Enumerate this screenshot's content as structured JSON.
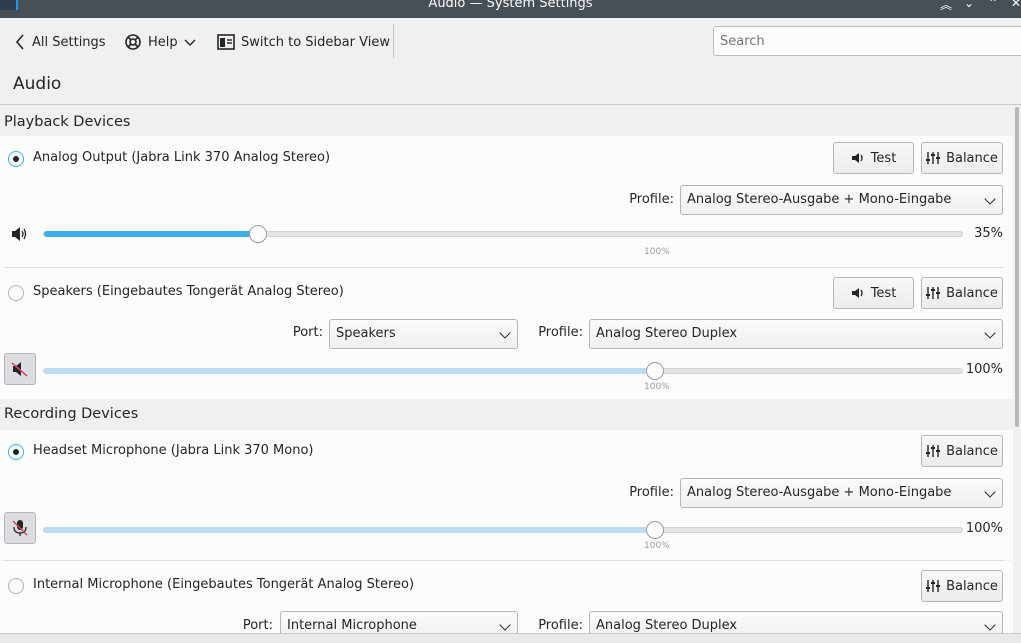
{
  "window": {
    "title": "Audio — System Settings"
  },
  "toolbar": {
    "all_settings": "All Settings",
    "help": "Help",
    "sidebar_view": "Switch to Sidebar View",
    "search_placeholder": "Search"
  },
  "page": {
    "title": "Audio"
  },
  "playback": {
    "header": "Playback Devices",
    "devices": [
      {
        "label": "Analog Output (Jabra Link 370 Analog Stereo)",
        "selected": true,
        "test": "Test",
        "balance": "Balance",
        "profile_label": "Profile:",
        "profile": "Analog Stereo-Ausgabe + Mono-Eingabe",
        "volume": 0.35,
        "volume_text": "35%",
        "mark": "100%"
      },
      {
        "label": "Speakers (Eingebautes Tongerät Analog Stereo)",
        "selected": false,
        "test": "Test",
        "balance": "Balance",
        "port_label": "Port:",
        "port": "Speakers",
        "profile_label": "Profile:",
        "profile": "Analog Stereo Duplex",
        "volume": 1.0,
        "volume_text": "100%",
        "mark": "100%",
        "muted": true
      }
    ]
  },
  "recording": {
    "header": "Recording Devices",
    "devices": [
      {
        "label": "Headset Microphone (Jabra Link 370 Mono)",
        "selected": true,
        "balance": "Balance",
        "profile_label": "Profile:",
        "profile": "Analog Stereo-Ausgabe + Mono-Eingabe",
        "volume": 1.0,
        "volume_text": "100%",
        "mark": "100%",
        "muted": true
      },
      {
        "label": "Internal Microphone (Eingebautes Tongerät Analog Stereo)",
        "selected": false,
        "balance": "Balance",
        "port_label": "Port:",
        "port": "Internal Microphone",
        "profile_label": "Profile:",
        "profile": "Analog Stereo Duplex"
      }
    ]
  },
  "colors": {
    "accent": "#3daee9",
    "titlebar": "#475057",
    "background": "#eff0f1",
    "card": "#fcfcfc"
  }
}
